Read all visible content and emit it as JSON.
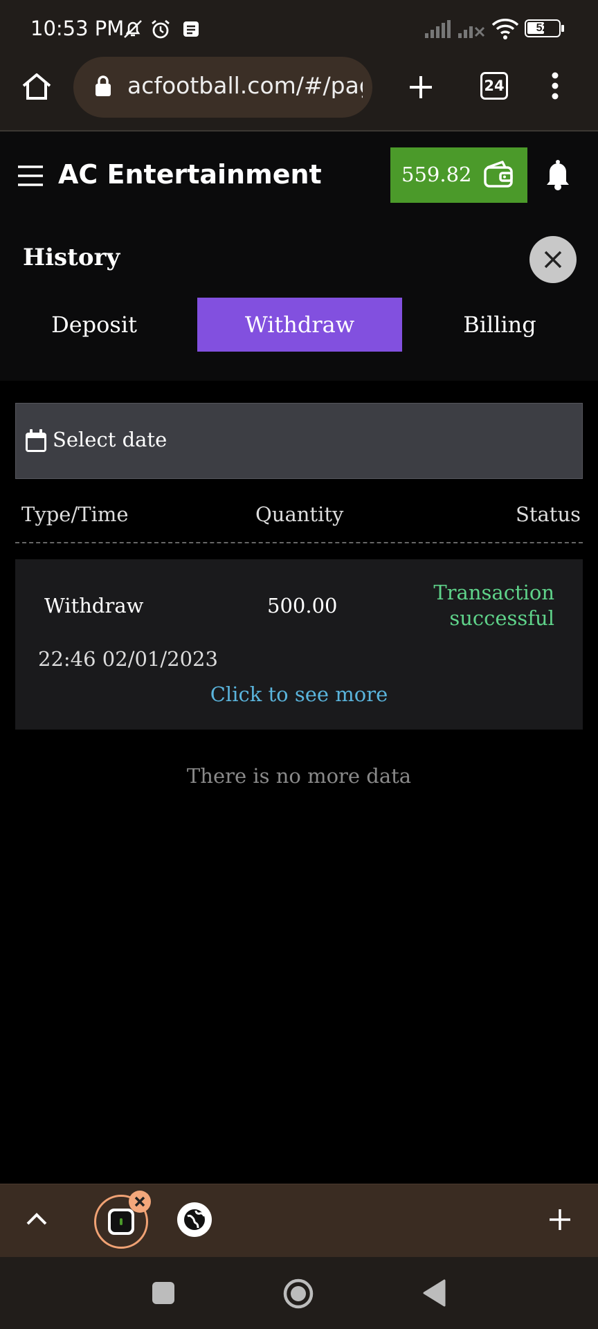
{
  "status_bar": {
    "time": "10:53 PM",
    "battery": "52"
  },
  "browser": {
    "url": "acfootball.com/#/pag",
    "tab_count": "24"
  },
  "app": {
    "title": "AC Entertainment",
    "balance": "559.82"
  },
  "history": {
    "title": "History",
    "tabs": {
      "deposit": "Deposit",
      "withdraw": "Withdraw",
      "billing": "Billing"
    },
    "active_tab": "Withdraw",
    "date_placeholder": "Select date",
    "columns": {
      "type_time": "Type/Time",
      "quantity": "Quantity",
      "status": "Status"
    },
    "records": [
      {
        "type": "Withdraw",
        "quantity": "500.00",
        "status_line1": "Transaction",
        "status_line2": "successful",
        "time": "22:46 02/01/2023",
        "more": "Click to see more"
      }
    ],
    "empty_message": "There is no more data"
  },
  "colors": {
    "accent": "#8250df",
    "balance_bg": "#4b9a2a",
    "success": "#5fd38a",
    "link": "#5ab4dc"
  }
}
